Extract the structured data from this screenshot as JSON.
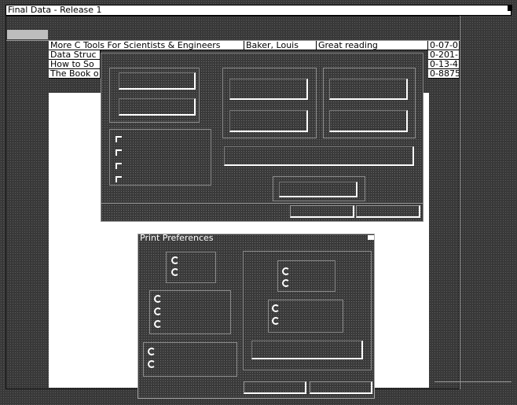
{
  "window": {
    "title": "Final Data - Release 1"
  },
  "table": {
    "rows": [
      {
        "title": "More C Tools For Scientists & Engineers",
        "author": "Baker, Louis",
        "comment": "Great reading",
        "isbn": "0-07-0"
      },
      {
        "title": "Data Struc",
        "author": "",
        "comment": "",
        "isbn": "0-201-"
      },
      {
        "title": "How to So",
        "author": "",
        "comment": "",
        "isbn": "0-13-4"
      },
      {
        "title": "The Book o",
        "author": "",
        "comment": "",
        "isbn": "0-8875"
      }
    ]
  },
  "print_dialog": {
    "title": "Print Preferences"
  }
}
